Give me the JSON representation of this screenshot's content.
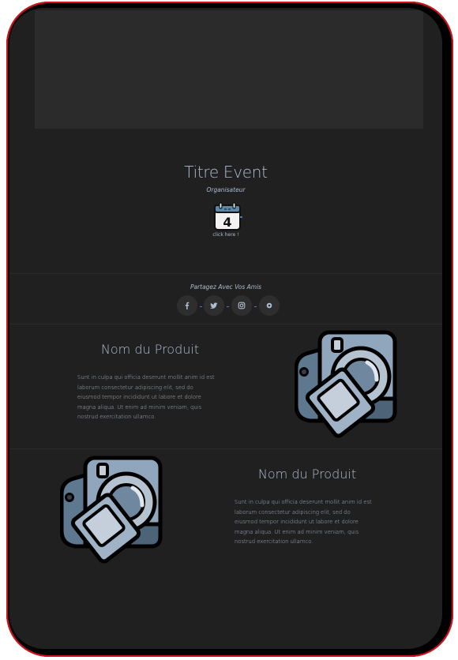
{
  "event": {
    "title": "Titre Event",
    "organizer": "Organisateur",
    "calendar_day": "4",
    "calendar_caption": "click here !"
  },
  "share": {
    "label": "Partagez Avec Vos Amis",
    "icons": [
      "facebook-icon",
      "twitter-icon",
      "instagram-icon",
      "circle-icon"
    ]
  },
  "products": [
    {
      "name": "Nom du Produit",
      "description": "Sunt in culpa qui officia deserunt mollit anim id est laborum consectetur adipiscing elit, sed do eiusmod tempor incididunt ut labore et dolore magna aliqua. Ut enim ad minim veniam, quis nostrud exercitation ullamco.",
      "image_icon": "camera-icon"
    },
    {
      "name": "Nom du Produit",
      "description": "Sunt in culpa qui officia deserunt mollit anim id est laborum consectetur adipiscing elit, sed do eiusmod tempor incididunt ut labore et dolore magna aliqua. Ut enim ad minim veniam, quis nostrud exercitation ullamco.",
      "image_icon": "camera-icon"
    }
  ],
  "colors": {
    "background": "#202020",
    "text": "#aebdcf",
    "device_edge": "#d01018",
    "accent": "#3a7fd0"
  }
}
